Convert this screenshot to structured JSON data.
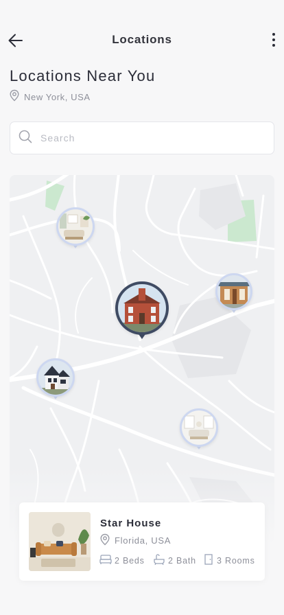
{
  "header": {
    "title": "Locations"
  },
  "page": {
    "heading": "Locations Near You",
    "location": "New York, USA"
  },
  "search": {
    "placeholder": "Search"
  },
  "map": {
    "pins": [
      {
        "name": "pin-living-room",
        "selected": false
      },
      {
        "name": "pin-wood-house",
        "selected": false
      },
      {
        "name": "pin-brick-house",
        "selected": true
      },
      {
        "name": "pin-white-house",
        "selected": false
      },
      {
        "name": "pin-bright-room",
        "selected": false
      }
    ]
  },
  "card": {
    "title": "Star House",
    "location": "Florida, USA",
    "beds": "2 Beds",
    "bath": "2 Bath",
    "rooms": "3 Rooms"
  },
  "colors": {
    "map_bg": "#eff0f2",
    "roads": "#ffffff",
    "parks": "#cbe8cf",
    "pin_ring": "#cdd7f0",
    "pin_selected": "#3f4b63",
    "muted_text": "#8d8f99"
  }
}
